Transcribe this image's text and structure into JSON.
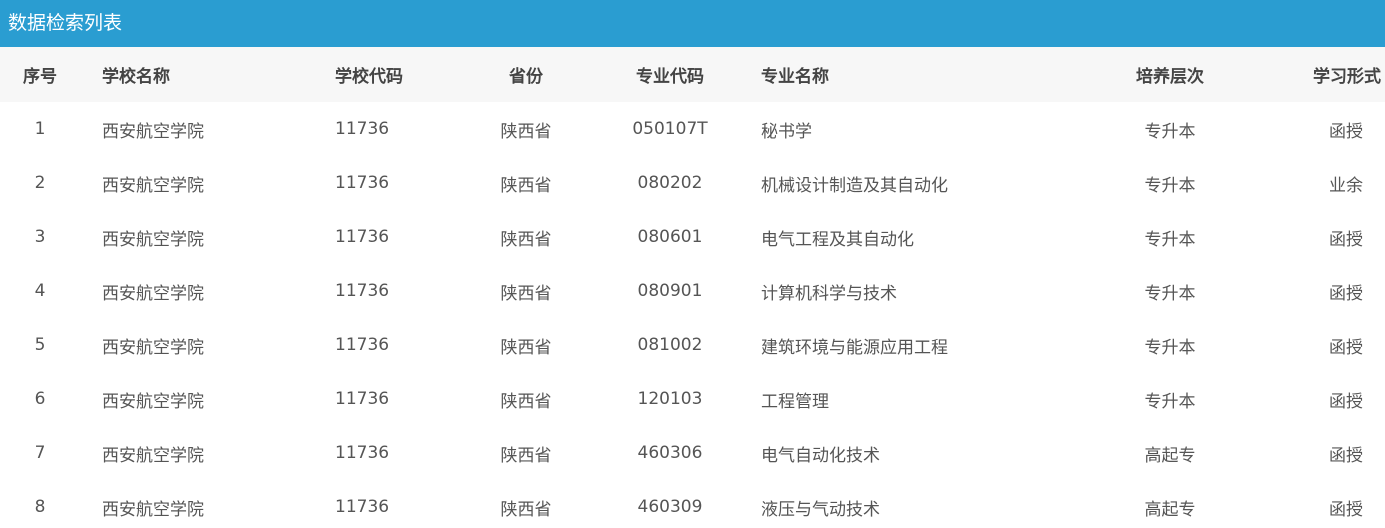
{
  "title": "数据检索列表",
  "columns": [
    "序号",
    "学校名称",
    "学校代码",
    "省份",
    "专业代码",
    "专业名称",
    "培养层次",
    "学习形式"
  ],
  "rows": [
    [
      "1",
      "西安航空学院",
      "11736",
      "陕西省",
      "050107T",
      "秘书学",
      "专升本",
      "函授"
    ],
    [
      "2",
      "西安航空学院",
      "11736",
      "陕西省",
      "080202",
      "机械设计制造及其自动化",
      "专升本",
      "业余"
    ],
    [
      "3",
      "西安航空学院",
      "11736",
      "陕西省",
      "080601",
      "电气工程及其自动化",
      "专升本",
      "函授"
    ],
    [
      "4",
      "西安航空学院",
      "11736",
      "陕西省",
      "080901",
      "计算机科学与技术",
      "专升本",
      "函授"
    ],
    [
      "5",
      "西安航空学院",
      "11736",
      "陕西省",
      "081002",
      "建筑环境与能源应用工程",
      "专升本",
      "函授"
    ],
    [
      "6",
      "西安航空学院",
      "11736",
      "陕西省",
      "120103",
      "工程管理",
      "专升本",
      "函授"
    ],
    [
      "7",
      "西安航空学院",
      "11736",
      "陕西省",
      "460306",
      "电气自动化技术",
      "高起专",
      "函授"
    ],
    [
      "8",
      "西安航空学院",
      "11736",
      "陕西省",
      "460309",
      "液压与气动技术",
      "高起专",
      "函授"
    ]
  ]
}
